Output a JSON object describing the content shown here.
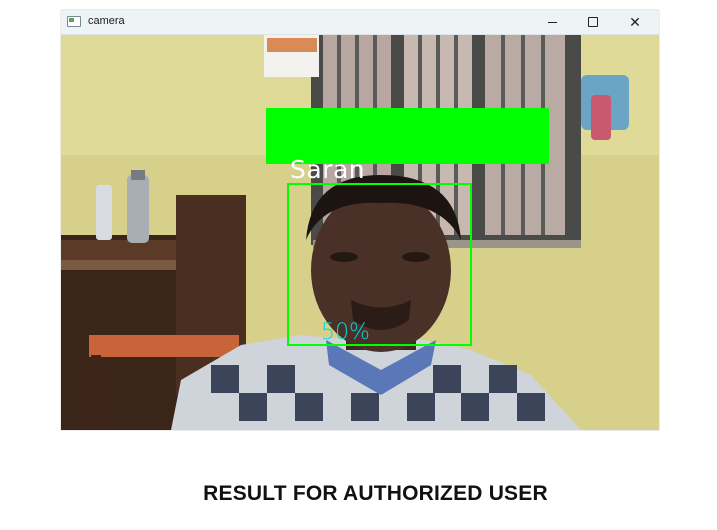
{
  "window": {
    "title": "camera",
    "icon": "camera-app-icon",
    "controls": [
      "minimize-icon",
      "maximize-icon",
      "close-icon"
    ],
    "close_glyph": "✕"
  },
  "overlay": {
    "identified_name": "Saran",
    "confidence": "50%",
    "box_color": "#00ff00",
    "confidence_color": "#00d8e0"
  },
  "caption": "RESULT FOR AUTHORIZED USER"
}
